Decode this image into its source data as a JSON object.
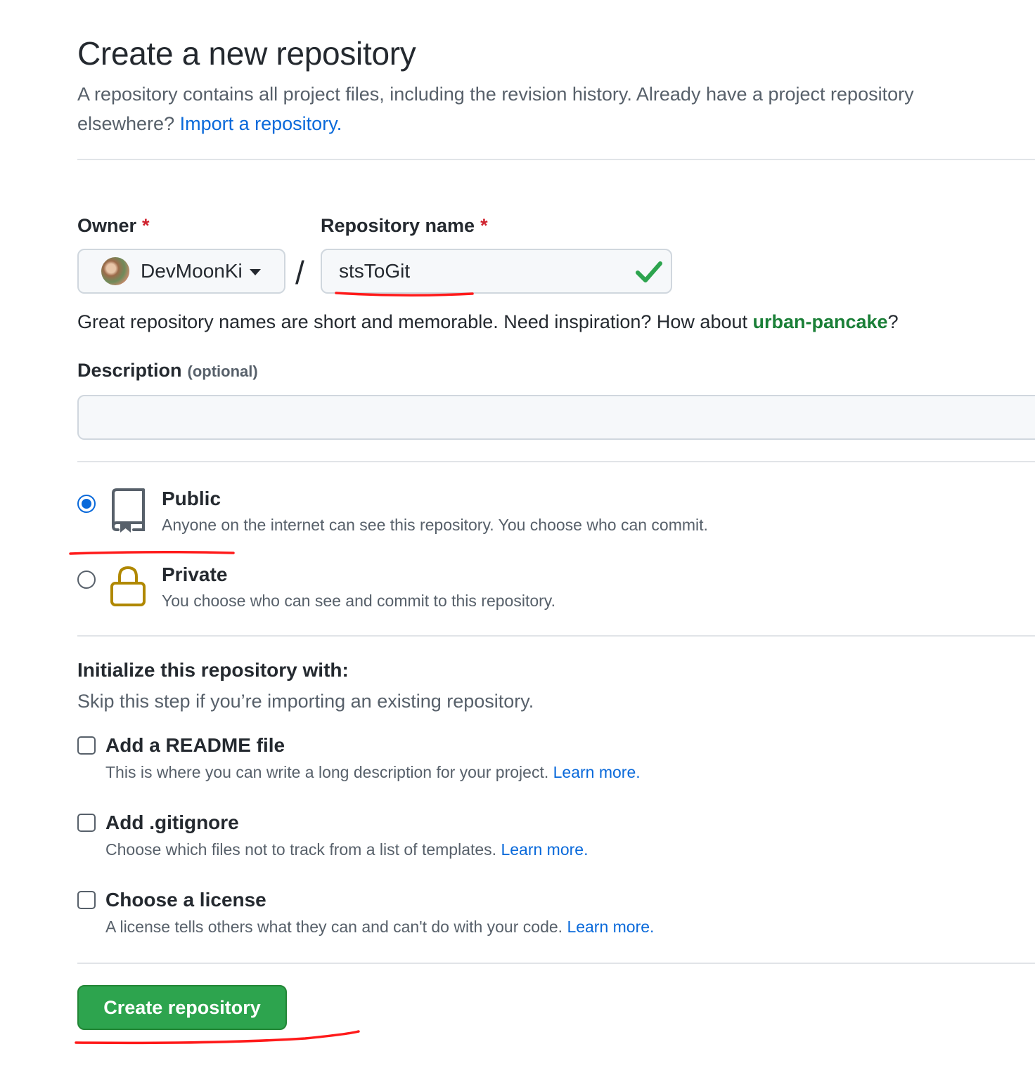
{
  "header": {
    "title": "Create a new repository",
    "subtitle": "A repository contains all project files, including the revision history. Already have a project repository elsewhere?",
    "import_link": "Import a repository."
  },
  "owner": {
    "label": "Owner",
    "required_mark": "*",
    "value": "DevMoonKi"
  },
  "separator": "/",
  "repo_name": {
    "label": "Repository name",
    "required_mark": "*",
    "value": "stsToGit",
    "valid_icon": "checkmark-icon"
  },
  "name_hint": {
    "text": "Great repository names are short and memorable. Need inspiration? How about",
    "suggestion": "urban-pancake",
    "end": "?"
  },
  "description": {
    "label": "Description",
    "optional": "(optional)",
    "value": ""
  },
  "visibility": {
    "selected": "public",
    "public": {
      "title": "Public",
      "desc": "Anyone on the internet can see this repository. You choose who can commit.",
      "icon": "repo-icon"
    },
    "private": {
      "title": "Private",
      "desc": "You choose who can see and commit to this repository.",
      "icon": "lock-icon"
    }
  },
  "initialize": {
    "title": "Initialize this repository with:",
    "subtitle": "Skip this step if you’re importing an existing repository.",
    "options": [
      {
        "title": "Add a README file",
        "desc": "This is where you can write a long description for your project.",
        "link": "Learn more.",
        "checked": false
      },
      {
        "title": "Add .gitignore",
        "desc": "Choose which files not to track from a list of templates.",
        "link": "Learn more.",
        "checked": false
      },
      {
        "title": "Choose a license",
        "desc": "A license tells others what they can and can't do with your code.",
        "link": "Learn more.",
        "checked": false
      }
    ]
  },
  "submit": {
    "label": "Create repository"
  },
  "colors": {
    "accent_blue": "#0969da",
    "success_green": "#2da44e",
    "suggestion_green": "#1a7f37",
    "required_red": "#cf222e",
    "lock_gold": "#b08800",
    "annotation_red": "#ff1a1a"
  }
}
